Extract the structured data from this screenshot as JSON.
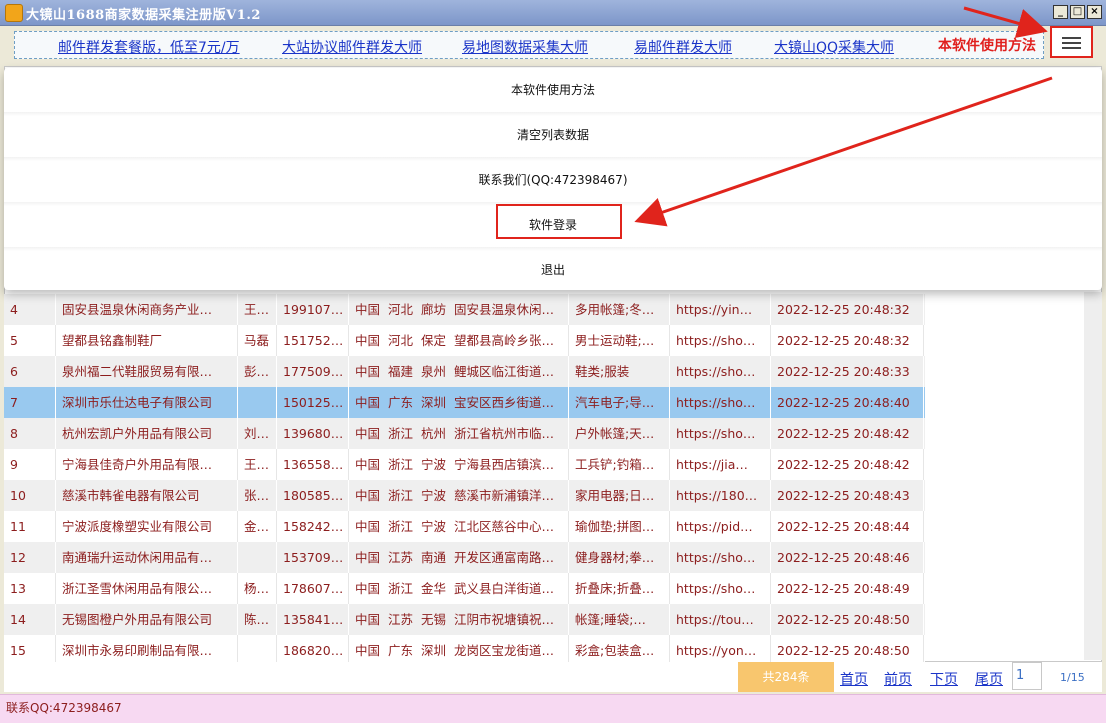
{
  "window": {
    "title": "大镜山1688商家数据采集注册版V1.2",
    "controls": [
      "_",
      "□",
      "×"
    ]
  },
  "linkbar": {
    "links": [
      "邮件群发套餐版，低至7元/万",
      "大站协议邮件群发大师",
      "易地图数据采集大师",
      "易邮件群发大师",
      "大镜山QQ采集大师"
    ],
    "howto": "本软件使用方法"
  },
  "menu": {
    "items": [
      "本软件使用方法",
      "清空列表数据",
      "联系我们(QQ:472398467)",
      "软件登录",
      "退出"
    ],
    "highlighted_item": "软件登录"
  },
  "table": {
    "rows": [
      {
        "idx": "4",
        "name": "固安县温泉休闲商务产业…",
        "contact": "王…",
        "phone": "199107…",
        "country": "中国",
        "province": "河北",
        "city": "廊坊",
        "address": "固安县温泉休闲…",
        "products": "多用帐篷;冬…",
        "url": "https://yin…",
        "time": "2022-12-25 20:48:32"
      },
      {
        "idx": "5",
        "name": "望都县铭鑫制鞋厂",
        "contact": "马磊",
        "phone": "151752…",
        "country": "中国",
        "province": "河北",
        "city": "保定",
        "address": "望都县高岭乡张…",
        "products": "男士运动鞋;…",
        "url": "https://sho…",
        "time": "2022-12-25 20:48:32"
      },
      {
        "idx": "6",
        "name": "泉州福二代鞋服贸易有限…",
        "contact": "彭…",
        "phone": "177509…",
        "country": "中国",
        "province": "福建",
        "city": "泉州",
        "address": "鲤城区临江街道…",
        "products": "鞋类;服装",
        "url": "https://sho…",
        "time": "2022-12-25 20:48:33"
      },
      {
        "idx": "7",
        "name": "深圳市乐仕达电子有限公司",
        "contact": "",
        "phone": "150125…",
        "country": "中国",
        "province": "广东",
        "city": "深圳",
        "address": "宝安区西乡街道…",
        "products": "汽车电子;导…",
        "url": "https://sho…",
        "time": "2022-12-25 20:48:40"
      },
      {
        "idx": "8",
        "name": "杭州宏凯户外用品有限公司",
        "contact": "刘…",
        "phone": "139680…",
        "country": "中国",
        "province": "浙江",
        "city": "杭州",
        "address": "浙江省杭州市临…",
        "products": "户外帐篷;天…",
        "url": "https://sho…",
        "time": "2022-12-25 20:48:42"
      },
      {
        "idx": "9",
        "name": "宁海县佳奇户外用品有限…",
        "contact": "王…",
        "phone": "136558…",
        "country": "中国",
        "province": "浙江",
        "city": "宁波",
        "address": "宁海县西店镇滨…",
        "products": "工兵铲;钓箱…",
        "url": "https://jia…",
        "time": "2022-12-25 20:48:42"
      },
      {
        "idx": "10",
        "name": "慈溪市韩雀电器有限公司",
        "contact": "张…",
        "phone": "180585…",
        "country": "中国",
        "province": "浙江",
        "city": "宁波",
        "address": "慈溪市新浦镇洋…",
        "products": "家用电器;日…",
        "url": "https://180…",
        "time": "2022-12-25 20:48:43"
      },
      {
        "idx": "11",
        "name": "宁波派度橡塑实业有限公司",
        "contact": "金…",
        "phone": "158242…",
        "country": "中国",
        "province": "浙江",
        "city": "宁波",
        "address": "江北区慈谷中心…",
        "products": "瑜伽垫;拼图…",
        "url": "https://pid…",
        "time": "2022-12-25 20:48:44"
      },
      {
        "idx": "12",
        "name": "南通瑞升运动休闲用品有…",
        "contact": "",
        "phone": "153709…",
        "country": "中国",
        "province": "江苏",
        "city": "南通",
        "address": "开发区通富南路…",
        "products": "健身器材;拳…",
        "url": "https://sho…",
        "time": "2022-12-25 20:48:46"
      },
      {
        "idx": "13",
        "name": "浙江圣雪休闲用品有限公…",
        "contact": "杨…",
        "phone": "178607…",
        "country": "中国",
        "province": "浙江",
        "city": "金华",
        "address": "武义县白洋街道…",
        "products": "折叠床;折叠…",
        "url": "https://sho…",
        "time": "2022-12-25 20:48:49"
      },
      {
        "idx": "14",
        "name": "无锡图橙户外用品有限公司",
        "contact": "陈…",
        "phone": "135841…",
        "country": "中国",
        "province": "江苏",
        "city": "无锡",
        "address": "江阴市祝塘镇祝…",
        "products": "帐篷;睡袋;…",
        "url": "https://tou…",
        "time": "2022-12-25 20:48:50"
      },
      {
        "idx": "15",
        "name": "深圳市永易印刷制品有限…",
        "contact": "",
        "phone": "186820…",
        "country": "中国",
        "province": "广东",
        "city": "深圳",
        "address": "龙岗区宝龙街道…",
        "products": "彩盒;包装盒…",
        "url": "https://yon…",
        "time": "2022-12-25 20:48:50"
      }
    ],
    "selected_idx": "7"
  },
  "pager": {
    "total": "共284条",
    "first": "首页",
    "prev": "前页",
    "next": "下页",
    "last": "尾页",
    "page_input": "1",
    "page_info": "1/15"
  },
  "statusbar": {
    "text": "联系QQ:472398467"
  },
  "colors": {
    "accent_red": "#e0241c",
    "link_blue": "#1a34c8",
    "selected_row": "#99c9ef",
    "total_badge": "#f8c66e",
    "status_bg": "#f7d9f2"
  },
  "icons": {
    "menu": "hamburger-menu-icon",
    "app": "app-logo-icon"
  }
}
